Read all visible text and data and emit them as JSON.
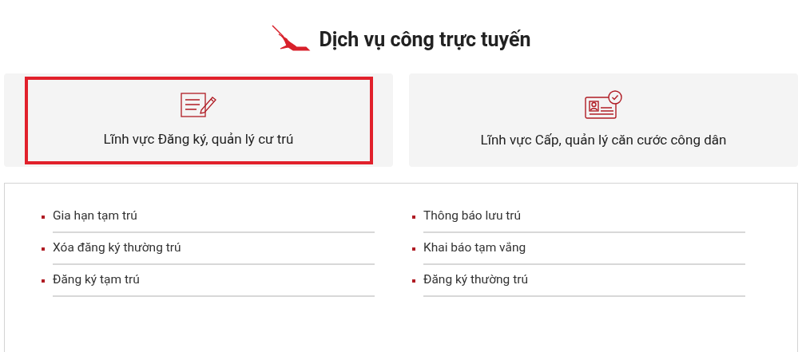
{
  "header": {
    "title": "Dịch vụ công trực tuyến"
  },
  "categories": [
    {
      "label": "Lĩnh vực Đăng ký, quản lý cư trú",
      "kind": "document",
      "selected": true
    },
    {
      "label": "Lĩnh vực Cấp, quản lý căn cước công dân",
      "kind": "id_card",
      "selected": false
    }
  ],
  "services": [
    {
      "column": [
        {
          "label": "Gia hạn tạm trú"
        },
        {
          "label": "Xóa đăng ký thường trú"
        },
        {
          "label": "Đăng ký tạm trú"
        }
      ]
    },
    {
      "column": [
        {
          "label": "Thông báo lưu trú"
        },
        {
          "label": "Khai báo tạm vắng"
        },
        {
          "label": "Đăng ký thường trú"
        }
      ]
    }
  ]
}
